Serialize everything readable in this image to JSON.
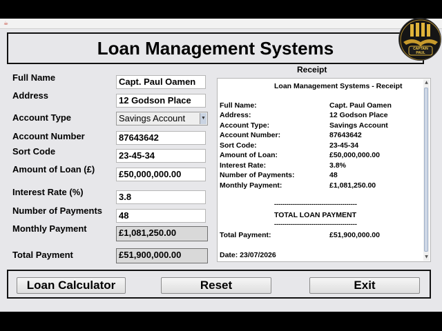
{
  "window": {
    "header_title": "Loan Management Systems"
  },
  "form": {
    "labels": {
      "full_name": "Full Name",
      "address": "Address",
      "account_type": "Account Type",
      "account_number": "Account Number",
      "sort_code": "Sort Code",
      "amount_of_loan": "Amount of Loan (£)",
      "interest_rate": "Interest Rate (%)",
      "number_of_payments": "Number of Payments",
      "monthly_payment": "Monthly Payment",
      "total_payment": "Total Payment"
    },
    "values": {
      "full_name": "Capt. Paul Oamen",
      "address": "12 Godson Place",
      "account_type": "Savings Account",
      "account_number": "87643642",
      "sort_code": "23-45-34",
      "amount_of_loan": "£50,000,000.00",
      "interest_rate": "3.8",
      "number_of_payments": "48",
      "monthly_payment": "£1,081,250.00",
      "total_payment": "£51,900,000.00"
    }
  },
  "receipt": {
    "heading": "Receipt",
    "title": "Loan Management Systems - Receipt",
    "rows": [
      {
        "label": "Full Name:",
        "value": "Capt. Paul Oamen"
      },
      {
        "label": "Address:",
        "value": "12 Godson Place"
      },
      {
        "label": "Account Type:",
        "value": "Savings Account"
      },
      {
        "label": "Account Number:",
        "value": "87643642"
      },
      {
        "label": "Sort Code:",
        "value": "23-45-34"
      },
      {
        "label": "Amount of Loan:",
        "value": "£50,000,000.00"
      },
      {
        "label": "Interest Rate:",
        "value": "3.8%"
      },
      {
        "label": "Number of Payments:",
        "value": "48"
      },
      {
        "label": "Monthly Payment:",
        "value": "£1,081,250.00"
      }
    ],
    "divider": "----------------------------------------",
    "total_heading": "TOTAL LOAN PAYMENT",
    "total_label": "Total Payment:",
    "total_value": "£51,900,000.00",
    "date_line": "Date: 23/07/2026"
  },
  "buttons": {
    "calculator": "Loan Calculator",
    "reset": "Reset",
    "exit": "Exit"
  },
  "logo": {
    "text": "CAPTAIN PAUL"
  },
  "icons": {
    "window_icon": "java-cup-icon",
    "combo_arrow": "chevron-down-icon"
  }
}
